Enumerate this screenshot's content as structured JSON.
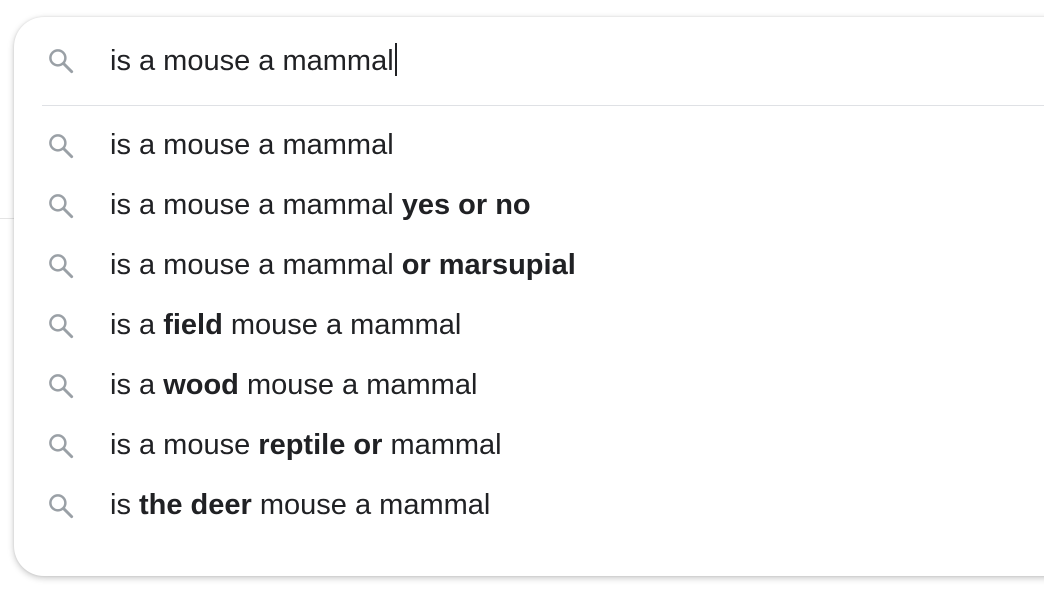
{
  "search": {
    "query": "is a mouse a mammal",
    "icon": "search-icon",
    "icon_color": "#9aa0a6",
    "text_color": "#202124"
  },
  "suggestions": [
    {
      "icon": "search-icon",
      "parts": [
        {
          "text": "is a mouse a mammal",
          "bold": false
        }
      ]
    },
    {
      "icon": "search-icon",
      "parts": [
        {
          "text": "is a mouse a mammal ",
          "bold": false
        },
        {
          "text": "yes or no",
          "bold": true
        }
      ]
    },
    {
      "icon": "search-icon",
      "parts": [
        {
          "text": "is a mouse a mammal ",
          "bold": false
        },
        {
          "text": "or marsupial",
          "bold": true
        }
      ]
    },
    {
      "icon": "search-icon",
      "parts": [
        {
          "text": "is a ",
          "bold": false
        },
        {
          "text": "field",
          "bold": true
        },
        {
          "text": " mouse a mammal",
          "bold": false
        }
      ]
    },
    {
      "icon": "search-icon",
      "parts": [
        {
          "text": "is a ",
          "bold": false
        },
        {
          "text": "wood",
          "bold": true
        },
        {
          "text": " mouse a mammal",
          "bold": false
        }
      ]
    },
    {
      "icon": "search-icon",
      "parts": [
        {
          "text": "is a mouse ",
          "bold": false
        },
        {
          "text": "reptile or",
          "bold": true
        },
        {
          "text": " mammal",
          "bold": false
        }
      ]
    },
    {
      "icon": "search-icon",
      "parts": [
        {
          "text": "is ",
          "bold": false
        },
        {
          "text": "the deer",
          "bold": true
        },
        {
          "text": " mouse a mammal",
          "bold": false
        }
      ]
    }
  ]
}
